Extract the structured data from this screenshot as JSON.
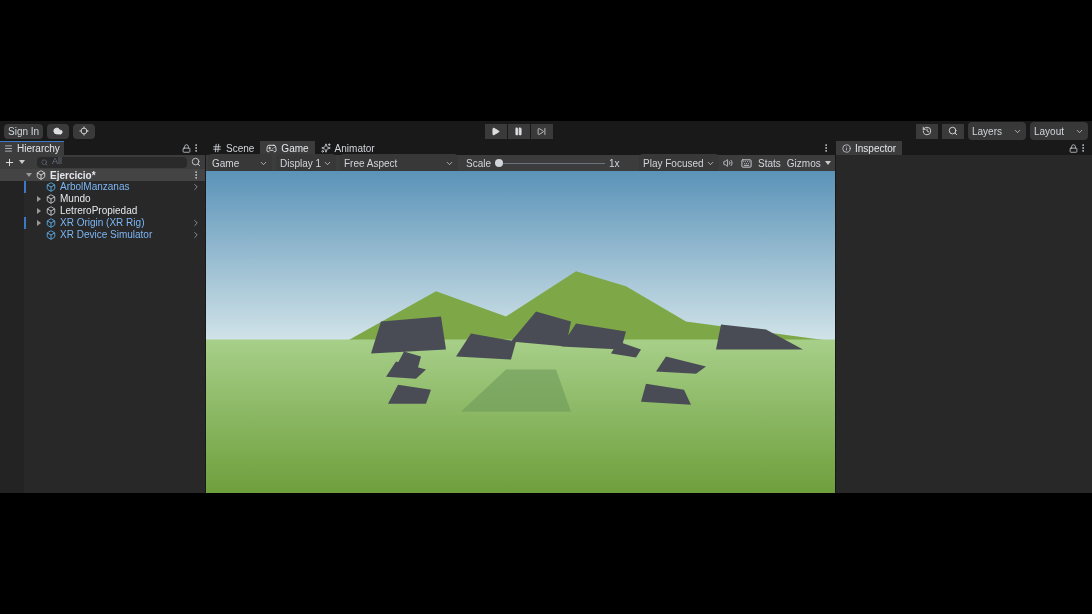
{
  "toolbar": {
    "sign_in": "Sign In",
    "layers": "Layers",
    "layout": "Layout"
  },
  "hierarchy": {
    "title": "Hierarchy",
    "search_placeholder": "All",
    "scene": {
      "name": "Ejercicio*",
      "expanded": true,
      "children": [
        {
          "name": "ArbolManzanas",
          "kind": "prefab",
          "overridden": true
        },
        {
          "name": "Mundo",
          "kind": "object",
          "expanded": false,
          "overridden": false
        },
        {
          "name": "LetreroPropiedad",
          "kind": "object",
          "expanded": false,
          "overridden": false
        },
        {
          "name": "XR Origin (XR Rig)",
          "kind": "prefab",
          "expanded": false,
          "overridden": true
        },
        {
          "name": "XR Device Simulator",
          "kind": "prefab",
          "overridden": false
        }
      ]
    }
  },
  "center_tabs": [
    {
      "label": "Scene",
      "kind": "scene",
      "selected": false
    },
    {
      "label": "Game",
      "kind": "game",
      "selected": true
    },
    {
      "label": "Animator",
      "kind": "animator",
      "selected": false
    }
  ],
  "game_bar": {
    "mode": "Game",
    "display": "Display 1",
    "aspect": "Free Aspect",
    "scale_label": "Scale",
    "scale": {
      "level": 0.0
    },
    "scale_value": "1x",
    "play_mode": "Play Focused",
    "stats": "Stats",
    "gizmos": "Gizmos"
  },
  "inspector": {
    "title": "Inspector"
  }
}
